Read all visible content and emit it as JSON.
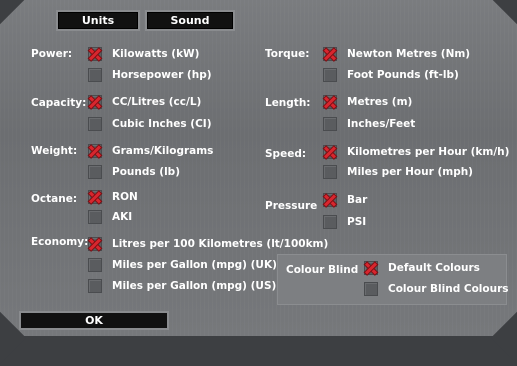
{
  "tabs": {
    "units": "Units",
    "sound": "Sound"
  },
  "sections": {
    "power": {
      "label": "Power:",
      "options": [
        "Kilowatts (kW)",
        "Horsepower (hp)"
      ],
      "selected": 0
    },
    "capacity": {
      "label": "Capacity:",
      "options": [
        "CC/Litres (cc/L)",
        "Cubic Inches (CI)"
      ],
      "selected": 0
    },
    "weight": {
      "label": "Weight:",
      "options": [
        "Grams/Kilograms",
        "Pounds (lb)"
      ],
      "selected": 0
    },
    "octane": {
      "label": "Octane:",
      "options": [
        "RON",
        "AKI"
      ],
      "selected": 0
    },
    "economy": {
      "label": "Economy:",
      "options": [
        "Litres per 100 Kilometres (lt/100km)",
        "Miles per Gallon (mpg) (UK)",
        "Miles per Gallon (mpg) (US)"
      ],
      "selected": 0
    },
    "torque": {
      "label": "Torque:",
      "options": [
        "Newton Metres (Nm)",
        "Foot Pounds (ft-lb)"
      ],
      "selected": 0
    },
    "length": {
      "label": "Length:",
      "options": [
        "Metres (m)",
        "Inches/Feet"
      ],
      "selected": 0
    },
    "speed": {
      "label": "Speed:",
      "options": [
        "Kilometres per Hour (km/h)",
        "Miles per Hour (mph)"
      ],
      "selected": 0
    },
    "pressure": {
      "label": "Pressure",
      "options": [
        "Bar",
        "PSI"
      ],
      "selected": 0
    },
    "colour_blind": {
      "label": "Colour Blind",
      "options": [
        "Default Colours",
        "Colour Blind Colours"
      ],
      "selected": 0
    }
  },
  "ok_button": "OK",
  "colors": {
    "selected_mark": "#d8262e",
    "button_bg": "#111111",
    "panel_bg": "#6e7073"
  }
}
